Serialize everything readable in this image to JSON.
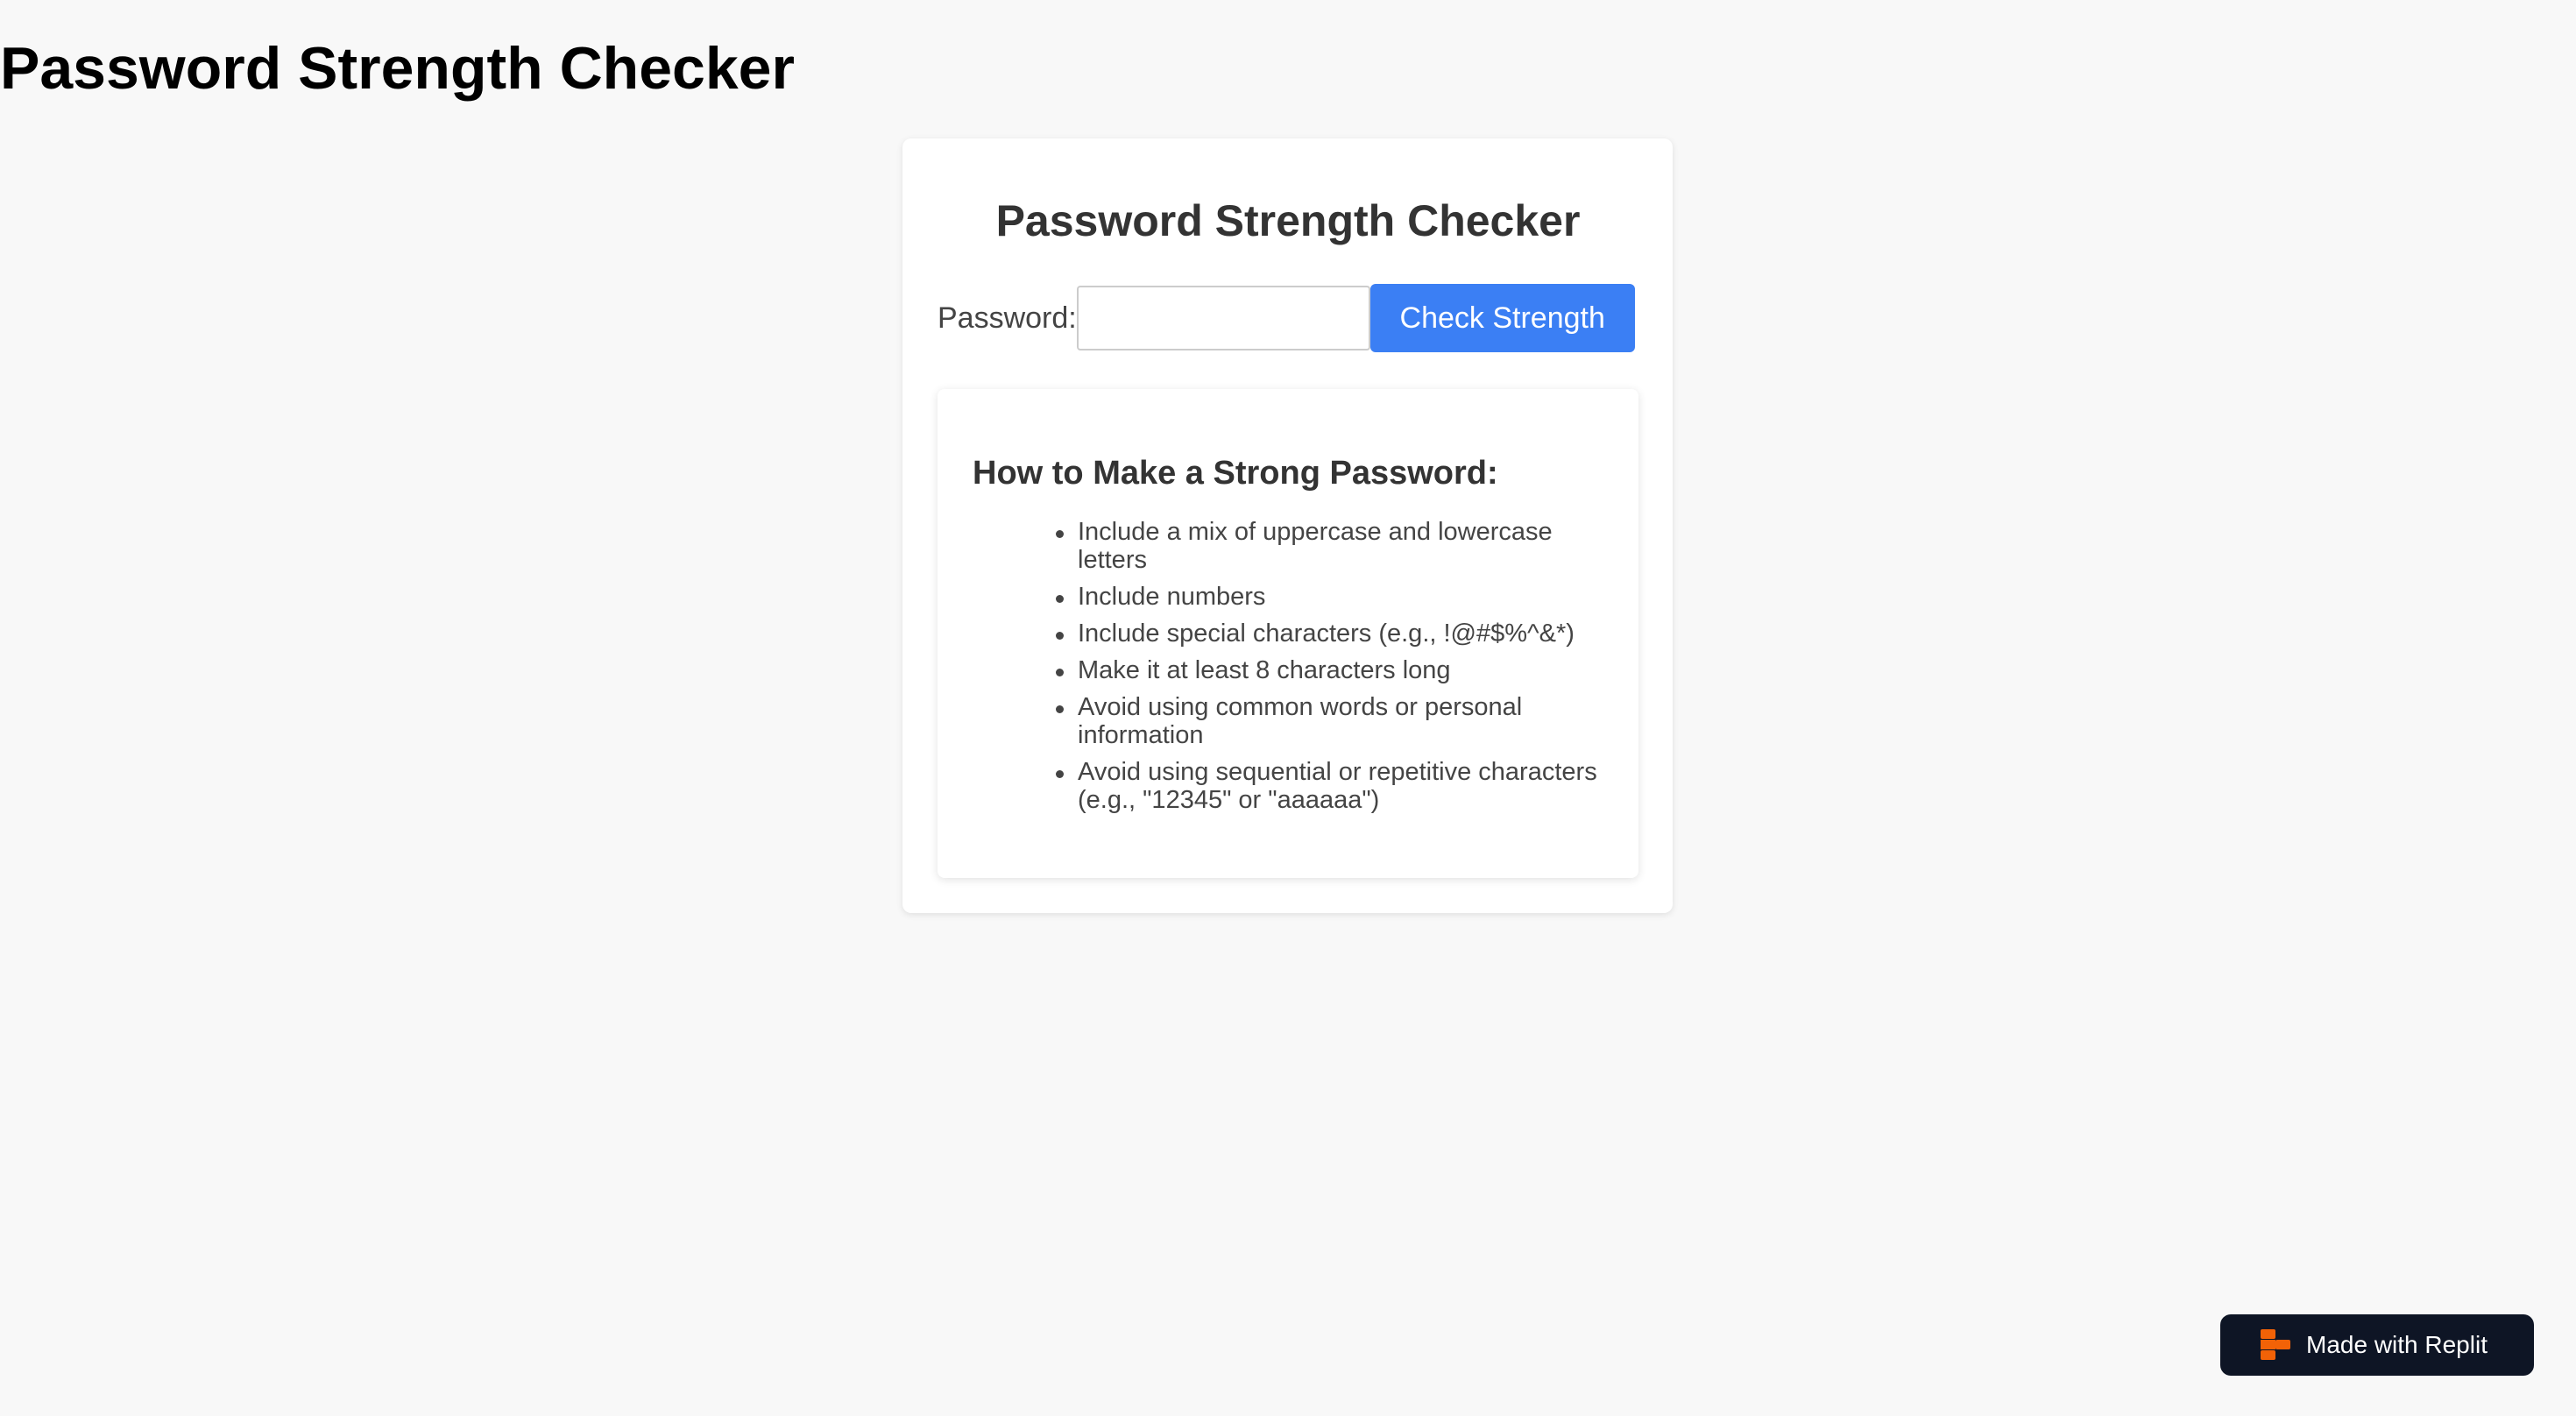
{
  "page": {
    "title": "Password Strength Checker"
  },
  "card": {
    "title": "Password Strength Checker",
    "password_label": "Password:",
    "password_value": "",
    "button_label": "Check Strength"
  },
  "tips": {
    "title": "How to Make a Strong Password:",
    "items": [
      "Include a mix of uppercase and lowercase letters",
      "Include numbers",
      "Include special characters (e.g., !@#$%^&*)",
      "Make it at least 8 characters long",
      "Avoid using common words or personal information",
      "Avoid using sequential or repetitive characters (e.g., \"12345\" or \"aaaaaa\")"
    ]
  },
  "badge": {
    "label": "Made with Replit",
    "icon": "replit-logo-icon",
    "icon_color": "#f26207"
  },
  "colors": {
    "background": "#f8f8f8",
    "button": "#3b7ff4",
    "badge_background": "#0e1525"
  }
}
